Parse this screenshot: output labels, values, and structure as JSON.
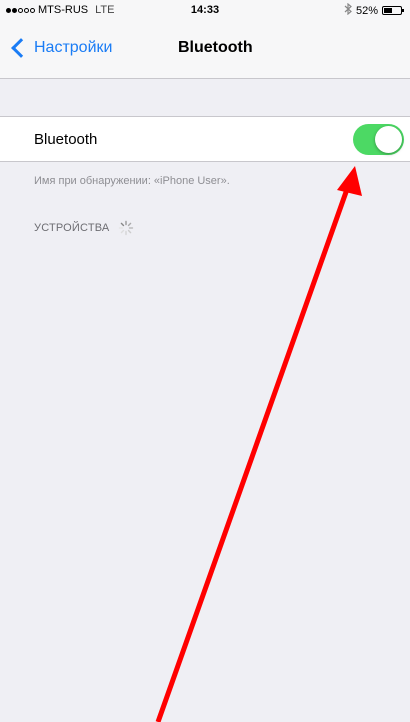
{
  "status_bar": {
    "carrier": "MTS-RUS",
    "network": "LTE",
    "time": "14:33",
    "battery_percent": "52%",
    "battery_level": 0.52,
    "signal_bars_filled": 2,
    "signal_bars_total": 5,
    "bluetooth_icon": "bluetooth-icon"
  },
  "nav": {
    "back_label": "Настройки",
    "title": "Bluetooth"
  },
  "bluetooth_row": {
    "label": "Bluetooth",
    "enabled": true
  },
  "discover_note": "Имя при обнаружении: «iPhone User».",
  "devices_header": "УСТРОЙСТВА",
  "colors": {
    "accent": "#1a7cf5",
    "toggle_on": "#4cd964",
    "background": "#efeff4",
    "annotation_arrow": "#ff0000"
  },
  "icons": {
    "back": "chevron-left-icon",
    "spinner": "loading-spinner-icon",
    "annotation": "red-arrow-annotation"
  }
}
